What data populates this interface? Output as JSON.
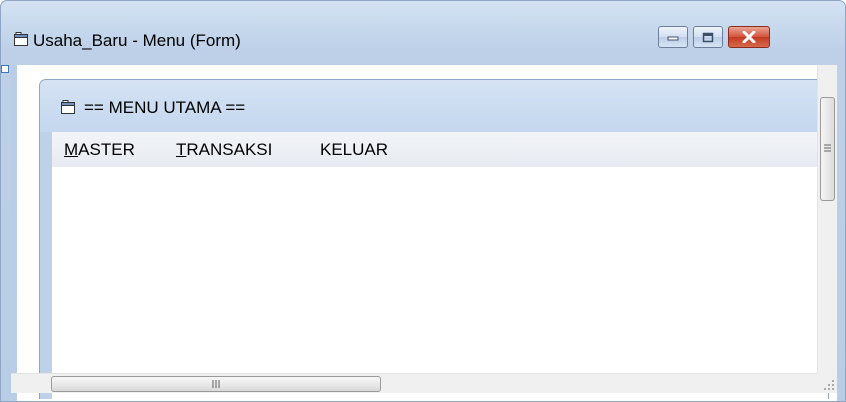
{
  "window": {
    "title": "Usaha_Baru - Menu (Form)",
    "icon": "form-icon",
    "controls": [
      "minimize-icon",
      "maximize-icon",
      "close-icon"
    ]
  },
  "form": {
    "title": "== MENU UTAMA ==",
    "icon": "form-icon",
    "menu": [
      {
        "access_key": "M",
        "rest": "ASTER"
      },
      {
        "access_key": "T",
        "rest": "RANSAKSI"
      },
      {
        "access_key": "",
        "rest": "KELUAR"
      }
    ]
  },
  "scrollbars": {
    "vertical_position": 0,
    "horizontal_position": 0
  },
  "colors": {
    "frame": "#bdd1e9",
    "close_button": "#c8452d",
    "menubar": "#eceff4"
  }
}
